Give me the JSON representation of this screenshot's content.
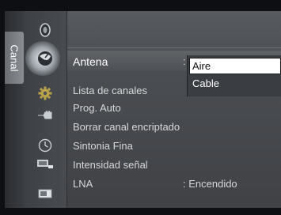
{
  "tab": {
    "label": "Canal"
  },
  "icons": [
    {
      "name": "picture-icon",
      "active": false
    },
    {
      "name": "channel-satellite-icon",
      "active": true
    },
    {
      "name": "setup-gear-icon",
      "active": false
    },
    {
      "name": "input-plug-icon",
      "active": false
    },
    {
      "name": "timer-clock-icon",
      "active": false
    },
    {
      "name": "application-list-icon",
      "active": false
    },
    {
      "name": "support-screen-icon",
      "active": false
    }
  ],
  "menu": {
    "items": [
      {
        "label": "Antena",
        "value": ":",
        "selected": true
      },
      {
        "label": "Lista de canales",
        "value": ""
      },
      {
        "label": "Prog. Auto",
        "value": ""
      },
      {
        "label": "Borrar canal encriptado",
        "value": ""
      },
      {
        "label": "Sintonia Fina",
        "value": ""
      },
      {
        "label": "Intensidad señal",
        "value": ""
      },
      {
        "label": "LNA",
        "value": ": Encendido"
      }
    ]
  },
  "dropdown": {
    "options": [
      {
        "label": "Aire",
        "highlighted": true
      },
      {
        "label": "Cable",
        "highlighted": false
      }
    ]
  }
}
